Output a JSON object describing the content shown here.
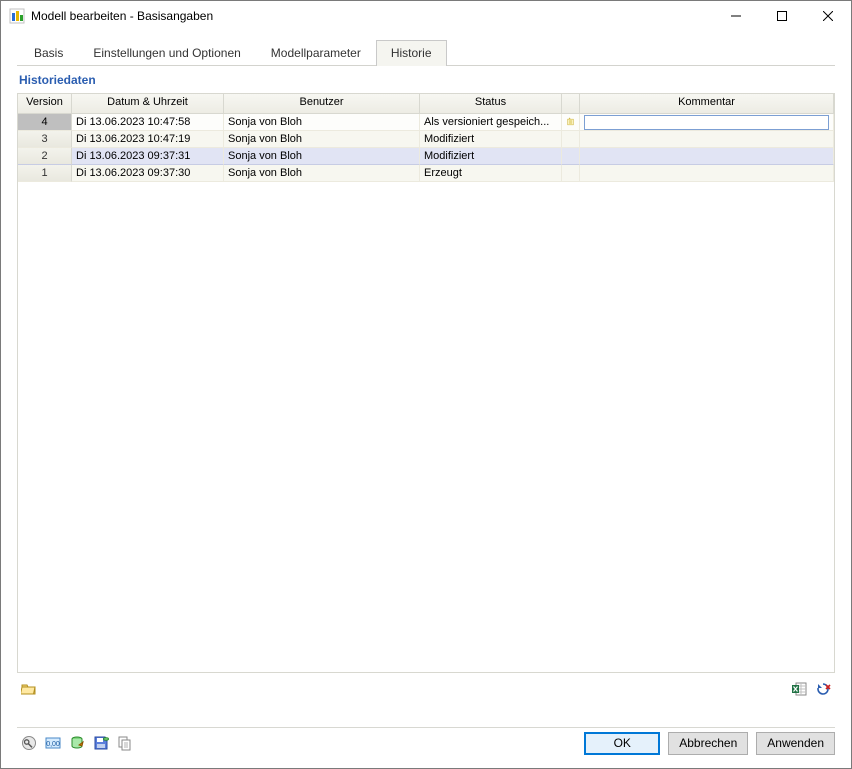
{
  "window": {
    "title": "Modell bearbeiten - Basisangaben"
  },
  "tabs": {
    "basis": "Basis",
    "options": "Einstellungen und Optionen",
    "params": "Modellparameter",
    "history": "Historie"
  },
  "section": {
    "history_label": "Historiedaten"
  },
  "grid": {
    "headers": {
      "version": "Version",
      "datetime": "Datum & Uhrzeit",
      "user": "Benutzer",
      "status": "Status",
      "comment": "Kommentar"
    },
    "rows": [
      {
        "version": "4",
        "datetime": "Di 13.06.2023 10:47:58",
        "user": "Sonja von Bloh",
        "status": "Als versioniert gespeich...",
        "icon": "note-icon",
        "comment": "",
        "current": true
      },
      {
        "version": "3",
        "datetime": "Di 13.06.2023 10:47:19",
        "user": "Sonja von Bloh",
        "status": "Modifiziert",
        "icon": "",
        "comment": "",
        "current": false
      },
      {
        "version": "2",
        "datetime": "Di 13.06.2023 09:37:31",
        "user": "Sonja von Bloh",
        "status": "Modifiziert",
        "icon": "",
        "comment": "",
        "current": false,
        "selected": true
      },
      {
        "version": "1",
        "datetime": "Di 13.06.2023 09:37:30",
        "user": "Sonja von Bloh",
        "status": "Erzeugt",
        "icon": "",
        "comment": "",
        "current": false
      }
    ]
  },
  "buttons": {
    "ok": "OK",
    "cancel": "Abbrechen",
    "apply": "Anwenden"
  }
}
